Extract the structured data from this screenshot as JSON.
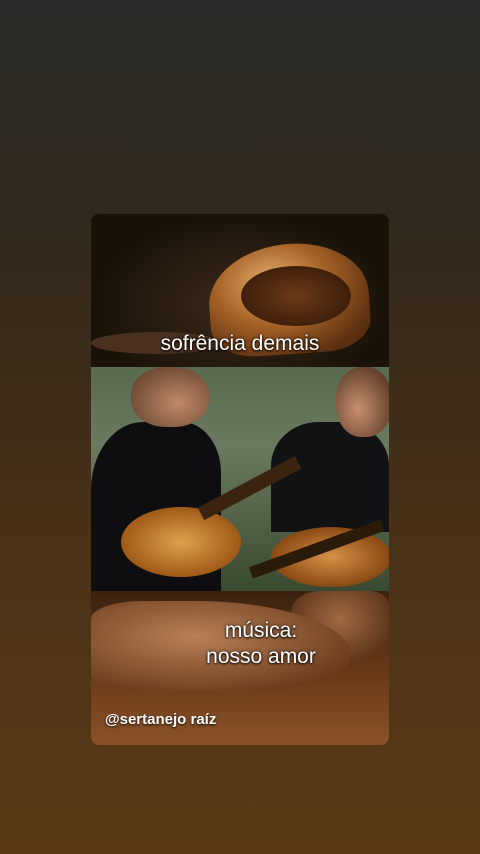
{
  "story": {
    "caption_top": "sofrência demais",
    "caption_bottom_line1": "música:",
    "caption_bottom_line2": "nosso amor",
    "handle": "@sertanejo raíz"
  }
}
